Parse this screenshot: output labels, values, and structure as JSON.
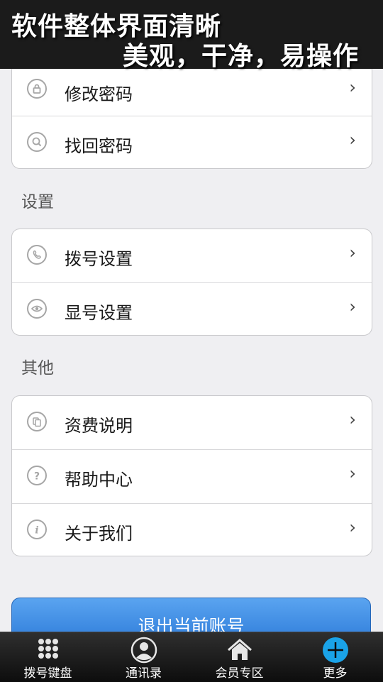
{
  "banner": {
    "line1": "软件整体界面清晰",
    "line2": "美观，干净，易操作"
  },
  "account_group": {
    "items": [
      {
        "label": "修改密码",
        "icon": "lock-icon"
      },
      {
        "label": "找回密码",
        "icon": "search-icon"
      }
    ]
  },
  "settings": {
    "title": "设置",
    "items": [
      {
        "label": "拨号设置",
        "icon": "phone-icon"
      },
      {
        "label": "显号设置",
        "icon": "eye-icon"
      }
    ]
  },
  "other": {
    "title": "其他",
    "items": [
      {
        "label": "资费说明",
        "icon": "copy-icon"
      },
      {
        "label": "帮助中心",
        "icon": "help-icon"
      },
      {
        "label": "关于我们",
        "icon": "info-icon"
      }
    ]
  },
  "chevron": "›",
  "logout_label": "退出当前账号",
  "tabbar": {
    "tabs": [
      {
        "label": "拨号键盘",
        "icon": "dialpad-icon"
      },
      {
        "label": "通讯录",
        "icon": "contacts-icon"
      },
      {
        "label": "会员专区",
        "icon": "home-icon"
      },
      {
        "label": "更多",
        "icon": "more-plus-icon",
        "active": true
      }
    ]
  },
  "colors": {
    "accent": "#2b79d8",
    "active_tab": "#1aa3e8"
  }
}
